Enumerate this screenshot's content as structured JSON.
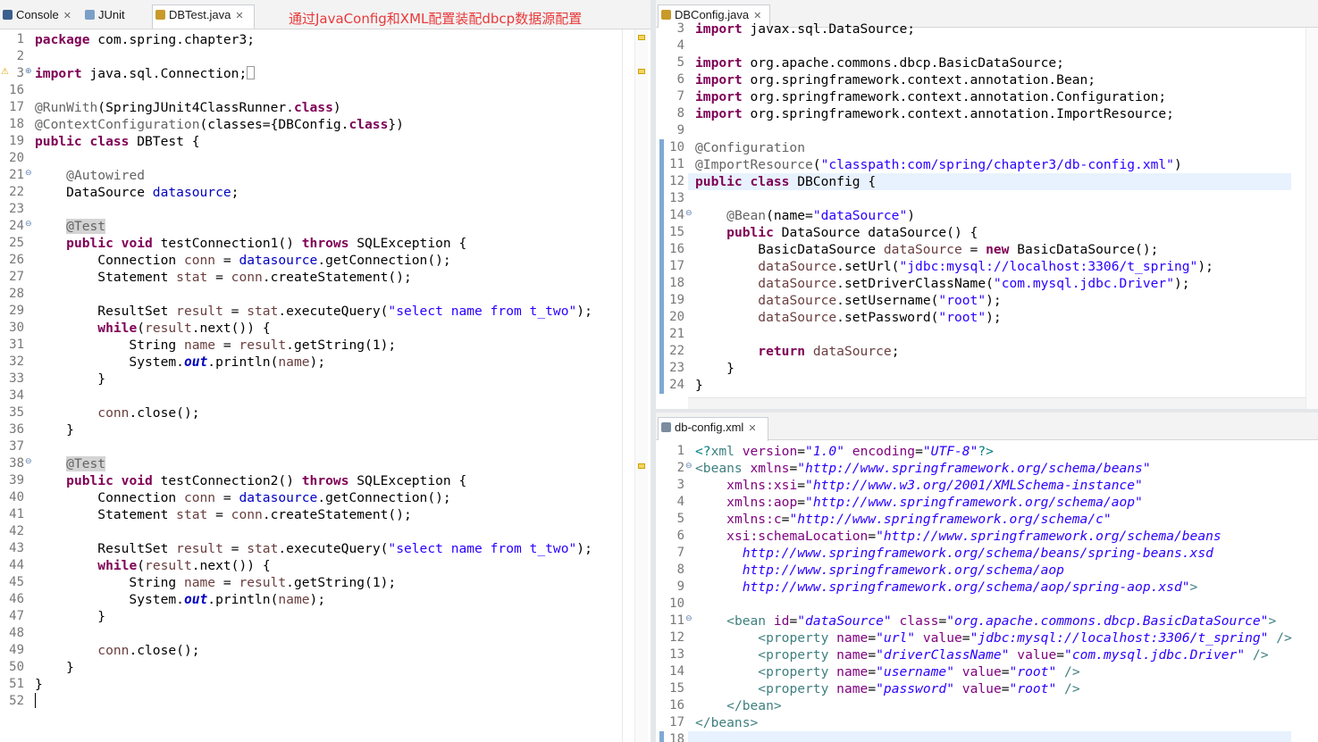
{
  "left_pane": {
    "tabs": [
      {
        "label": "Console",
        "icon": "console-icon"
      },
      {
        "label": "JUnit",
        "icon": "junit-icon"
      },
      {
        "label": "DBTest.java",
        "icon": "java-file-icon"
      }
    ],
    "annotation": "通过JavaConfig和XML配置装配dbcp数据源配置",
    "lines": [
      {
        "n": "1",
        "html": "<span class=\"kw\">package</span> com.spring.chapter3;"
      },
      {
        "n": "2",
        "html": ""
      },
      {
        "n": "3",
        "html": "<span class=\"kw\">import</span> java.sql.Connection;<span style=\"border:1px solid #999;display:inline-block;width:7px;height:13px;vertical-align:-2px\"></span>"
      },
      {
        "n": "16",
        "html": ""
      },
      {
        "n": "17",
        "html": "<span class=\"ann\">@RunWith</span>(SpringJUnit4ClassRunner.<span class=\"kw\">class</span>)"
      },
      {
        "n": "18",
        "html": "<span class=\"ann\">@ContextConfiguration</span>(classes={DBConfig.<span class=\"kw\">class</span>})"
      },
      {
        "n": "19",
        "html": "<span class=\"kw\">public</span> <span class=\"kw\">class</span> DBTest {"
      },
      {
        "n": "20",
        "html": ""
      },
      {
        "n": "21",
        "html": "    <span class=\"ann\">@Autowired</span>"
      },
      {
        "n": "22",
        "html": "    DataSource <span class=\"fld\">datasource</span>;"
      },
      {
        "n": "23",
        "html": ""
      },
      {
        "n": "24",
        "html": "    <span class=\"ann hl\">@Test</span>"
      },
      {
        "n": "25",
        "html": "    <span class=\"kw\">public</span> <span class=\"kw\">void</span> testConnection1() <span class=\"kw\">throws</span> SQLException {"
      },
      {
        "n": "26",
        "html": "        Connection <span class=\"var\">conn</span> = <span class=\"fld\">datasource</span>.getConnection();"
      },
      {
        "n": "27",
        "html": "        Statement <span class=\"var\">stat</span> = <span class=\"var\">conn</span>.createStatement();"
      },
      {
        "n": "28",
        "html": ""
      },
      {
        "n": "29",
        "html": "        ResultSet <span class=\"var\">result</span> = <span class=\"var\">stat</span>.executeQuery(<span class=\"str\">\"select name from t_two\"</span>);"
      },
      {
        "n": "30",
        "html": "        <span class=\"kw\">while</span>(<span class=\"var\">result</span>.next()) {"
      },
      {
        "n": "31",
        "html": "            String <span class=\"var\">name</span> = <span class=\"var\">result</span>.getString(1);"
      },
      {
        "n": "32",
        "html": "            System.<span class=\"sfld\">out</span>.println(<span class=\"var\">name</span>);"
      },
      {
        "n": "33",
        "html": "        }"
      },
      {
        "n": "34",
        "html": ""
      },
      {
        "n": "35",
        "html": "        <span class=\"var\">conn</span>.close();"
      },
      {
        "n": "36",
        "html": "    }"
      },
      {
        "n": "37",
        "html": ""
      },
      {
        "n": "38",
        "html": "    <span class=\"ann hl\">@Test</span>"
      },
      {
        "n": "39",
        "html": "    <span class=\"kw\">public</span> <span class=\"kw\">void</span> testConnection2() <span class=\"kw\">throws</span> SQLException {"
      },
      {
        "n": "40",
        "html": "        Connection <span class=\"var\">conn</span> = <span class=\"fld\">datasource</span>.getConnection();"
      },
      {
        "n": "41",
        "html": "        Statement <span class=\"var\">stat</span> = <span class=\"var\">conn</span>.createStatement();"
      },
      {
        "n": "42",
        "html": ""
      },
      {
        "n": "43",
        "html": "        ResultSet <span class=\"var\">result</span> = <span class=\"var\">stat</span>.executeQuery(<span class=\"str\">\"select name from t_two\"</span>);"
      },
      {
        "n": "44",
        "html": "        <span class=\"kw\">while</span>(<span class=\"var\">result</span>.next()) {"
      },
      {
        "n": "45",
        "html": "            String <span class=\"var\">name</span> = <span class=\"var\">result</span>.getString(1);"
      },
      {
        "n": "46",
        "html": "            System.<span class=\"sfld\">out</span>.println(<span class=\"var\">name</span>);"
      },
      {
        "n": "47",
        "html": "        }"
      },
      {
        "n": "48",
        "html": ""
      },
      {
        "n": "49",
        "html": "        <span class=\"var\">conn</span>.close();"
      },
      {
        "n": "50",
        "html": "    }"
      },
      {
        "n": "51",
        "html": "}"
      },
      {
        "n": "52",
        "html": ""
      }
    ]
  },
  "right_top_pane": {
    "tab": {
      "label": "DBConfig.java",
      "icon": "java-file-icon"
    },
    "lines": [
      {
        "n": "3",
        "html": "<span class=\"kw\">import</span> javax.sql.DataSource;"
      },
      {
        "n": "4",
        "html": ""
      },
      {
        "n": "5",
        "html": "<span class=\"kw\">import</span> org.apache.commons.dbcp.BasicDataSource;"
      },
      {
        "n": "6",
        "html": "<span class=\"kw\">import</span> org.springframework.context.annotation.Bean;"
      },
      {
        "n": "7",
        "html": "<span class=\"kw\">import</span> org.springframework.context.annotation.Configuration;"
      },
      {
        "n": "8",
        "html": "<span class=\"kw\">import</span> org.springframework.context.annotation.ImportResource;"
      },
      {
        "n": "9",
        "html": ""
      },
      {
        "n": "10",
        "html": "<span class=\"ann\">@Configuration</span>"
      },
      {
        "n": "11",
        "html": "<span class=\"ann\">@ImportResource</span>(<span class=\"str\">\"classpath:com/spring/chapter3/db-config.xml\"</span>)"
      },
      {
        "n": "12",
        "html": "<span class=\"kw\">public</span> <span class=\"kw\">class</span> DBConfig {"
      },
      {
        "n": "13",
        "html": ""
      },
      {
        "n": "14",
        "html": "    <span class=\"ann\">@Bean</span>(name=<span class=\"str\">\"dataSource\"</span>)"
      },
      {
        "n": "15",
        "html": "    <span class=\"kw\">public</span> DataSource dataSource() {"
      },
      {
        "n": "16",
        "html": "        BasicDataSource <span class=\"var\">dataSource</span> = <span class=\"kw\">new</span> BasicDataSource();"
      },
      {
        "n": "17",
        "html": "        <span class=\"var\">dataSource</span>.setUrl(<span class=\"str\">\"jdbc:mysql://localhost:3306/t_spring\"</span>);"
      },
      {
        "n": "18",
        "html": "        <span class=\"var\">dataSource</span>.setDriverClassName(<span class=\"str\">\"com.mysql.jdbc.Driver\"</span>);"
      },
      {
        "n": "19",
        "html": "        <span class=\"var\">dataSource</span>.setUsername(<span class=\"str\">\"root\"</span>);"
      },
      {
        "n": "20",
        "html": "        <span class=\"var\">dataSource</span>.setPassword(<span class=\"str\">\"root\"</span>);"
      },
      {
        "n": "21",
        "html": ""
      },
      {
        "n": "22",
        "html": "        <span class=\"kw\">return</span> <span class=\"var\">dataSource</span>;"
      },
      {
        "n": "23",
        "html": "    }"
      },
      {
        "n": "24",
        "html": "}"
      }
    ]
  },
  "right_bottom_pane": {
    "tab": {
      "label": "db-config.xml",
      "icon": "xml-file-icon"
    },
    "lines": [
      {
        "n": "1",
        "html": "<span class=\"xpi\">&lt;?</span><span class=\"xtag\">xml</span> <span class=\"xattr\">version</span>=<span class=\"xval\">\"1.0\"</span> <span class=\"xattr\">encoding</span>=<span class=\"xval\">\"UTF-8\"</span><span class=\"xpi\">?&gt;</span>"
      },
      {
        "n": "2",
        "html": "<span class=\"xtag\">&lt;beans</span> <span class=\"xattr\">xmlns</span>=<span class=\"xval\">\"http://www.springframework.org/schema/beans\"</span>"
      },
      {
        "n": "3",
        "html": "    <span class=\"xattr\">xmlns:xsi</span>=<span class=\"xval\">\"http://www.w3.org/2001/XMLSchema-instance\"</span>"
      },
      {
        "n": "4",
        "html": "    <span class=\"xattr\">xmlns:aop</span>=<span class=\"xval\">\"http://www.springframework.org/schema/aop\"</span>"
      },
      {
        "n": "5",
        "html": "    <span class=\"xattr\">xmlns:c</span>=<span class=\"xval\">\"http://www.springframework.org/schema/c\"</span>"
      },
      {
        "n": "6",
        "html": "    <span class=\"xattr\">xsi:schemaLocation</span>=<span class=\"xval\">\"http://www.springframework.org/schema/beans</span>"
      },
      {
        "n": "7",
        "html": "      <span class=\"xval\">http://www.springframework.org/schema/beans/spring-beans.xsd</span>"
      },
      {
        "n": "8",
        "html": "      <span class=\"xval\">http://www.springframework.org/schema/aop</span>"
      },
      {
        "n": "9",
        "html": "      <span class=\"xval\">http://www.springframework.org/schema/aop/spring-aop.xsd\"</span><span class=\"xtag\">&gt;</span>"
      },
      {
        "n": "10",
        "html": ""
      },
      {
        "n": "11",
        "html": "    <span class=\"xtag\">&lt;bean</span> <span class=\"xattr\">id</span>=<span class=\"xval\">\"dataSource\"</span> <span class=\"xattr\">class</span>=<span class=\"xval\">\"org.apache.commons.dbcp.BasicDataSource\"</span><span class=\"xtag\">&gt;</span>"
      },
      {
        "n": "12",
        "html": "        <span class=\"xtag\">&lt;property</span> <span class=\"xattr\">name</span>=<span class=\"xval\">\"url\"</span> <span class=\"xattr\">value</span>=<span class=\"xval\">\"jdbc:mysql://localhost:3306/t_spring\"</span> <span class=\"xtag\">/&gt;</span>"
      },
      {
        "n": "13",
        "html": "        <span class=\"xtag\">&lt;property</span> <span class=\"xattr\">name</span>=<span class=\"xval\">\"driverClassName\"</span> <span class=\"xattr\">value</span>=<span class=\"xval\">\"com.mysql.jdbc.Driver\"</span> <span class=\"xtag\">/&gt;</span>"
      },
      {
        "n": "14",
        "html": "        <span class=\"xtag\">&lt;property</span> <span class=\"xattr\">name</span>=<span class=\"xval\">\"username\"</span> <span class=\"xattr\">value</span>=<span class=\"xval\">\"root\"</span> <span class=\"xtag\">/&gt;</span>"
      },
      {
        "n": "15",
        "html": "        <span class=\"xtag\">&lt;property</span> <span class=\"xattr\">name</span>=<span class=\"xval\">\"password\"</span> <span class=\"xattr\">value</span>=<span class=\"xval\">\"root\"</span> <span class=\"xtag\">/&gt;</span>"
      },
      {
        "n": "16",
        "html": "    <span class=\"xtag\">&lt;/bean&gt;</span>"
      },
      {
        "n": "17",
        "html": "<span class=\"xtag\">&lt;/beans&gt;</span>"
      },
      {
        "n": "18",
        "html": ""
      }
    ]
  },
  "colors": {
    "keyword": "#7f0055",
    "string": "#2a00ff",
    "annotation": "#646464",
    "current_line": "#e8f2fe"
  }
}
